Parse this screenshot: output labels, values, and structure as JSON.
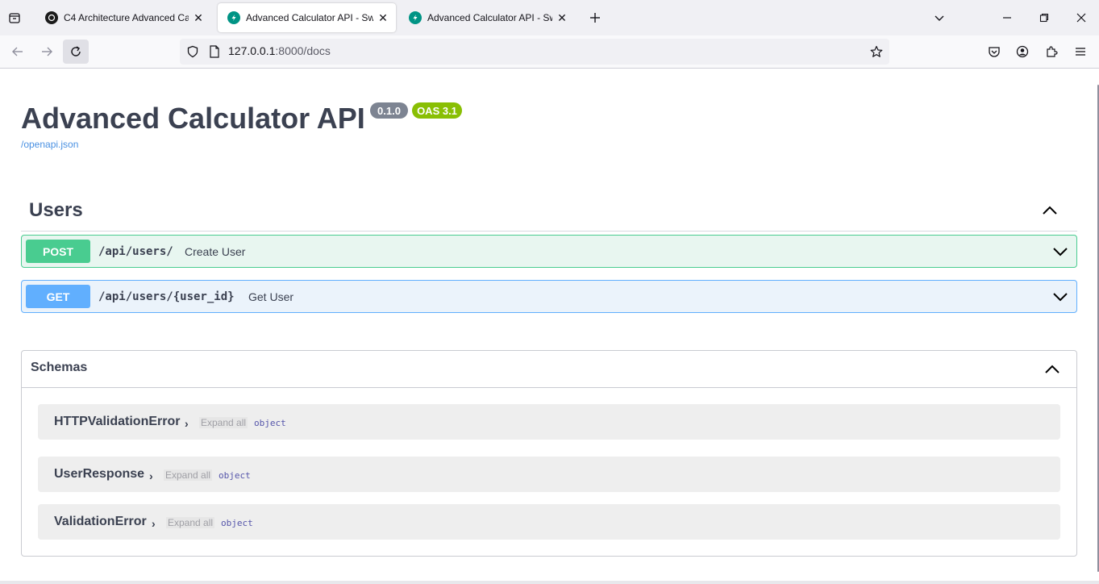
{
  "browser": {
    "tabs": [
      {
        "title": "C4 Architecture Advanced Calcul",
        "active": false,
        "favicon": "openai-icon"
      },
      {
        "title": "Advanced Calculator API - Swag",
        "active": true,
        "favicon": "fastapi-icon"
      },
      {
        "title": "Advanced Calculator API - Swag",
        "active": false,
        "favicon": "fastapi-icon"
      }
    ],
    "url_host": "127.0.0.1",
    "url_path": ":8000/docs"
  },
  "api": {
    "title": "Advanced Calculator API",
    "version": "0.1.0",
    "oas": "OAS 3.1",
    "openapi_link": "/openapi.json"
  },
  "tag": {
    "name": "Users",
    "operations": [
      {
        "method": "POST",
        "path": "/api/users/",
        "summary": "Create User",
        "color": "#49cc90"
      },
      {
        "method": "GET",
        "path": "/api/users/{user_id}",
        "summary": "Get User",
        "color": "#61affe"
      }
    ]
  },
  "schemas": {
    "title": "Schemas",
    "expand_label": "Expand all",
    "models": [
      {
        "name": "HTTPValidationError",
        "type": "object"
      },
      {
        "name": "UserResponse",
        "type": "object"
      },
      {
        "name": "ValidationError",
        "type": "object"
      }
    ]
  }
}
